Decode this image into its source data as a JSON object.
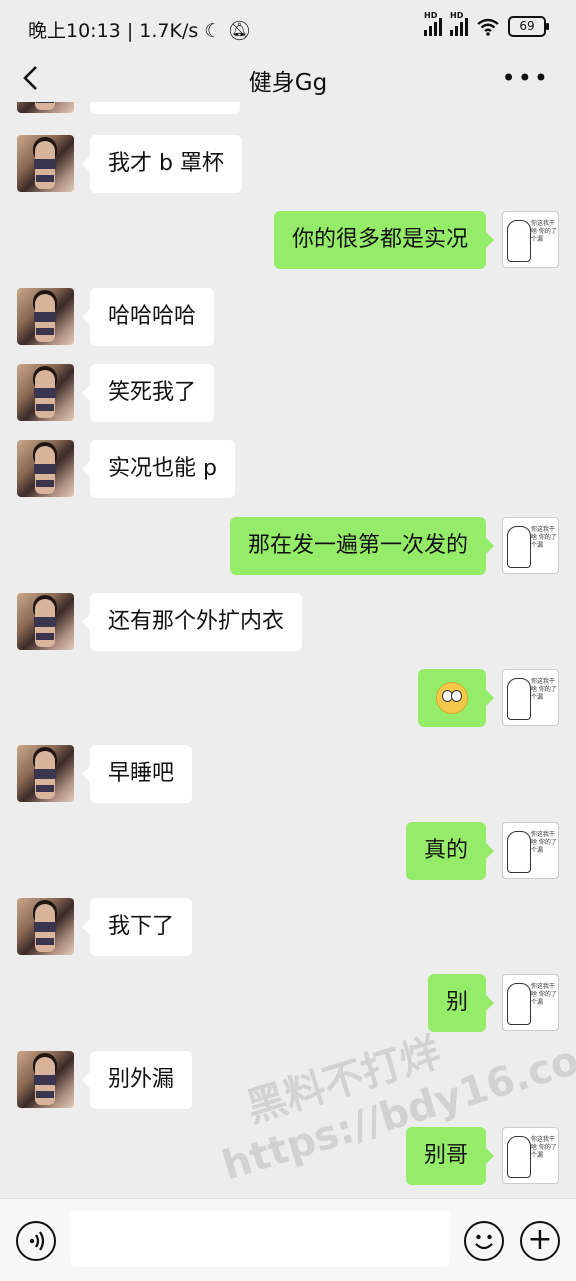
{
  "status": {
    "time": "晚上10:13",
    "speed": "1.7K/s",
    "battery": "69"
  },
  "nav": {
    "title": "健身Gg"
  },
  "messages": [
    {
      "side": "in",
      "text": "我才 b 罩杯"
    },
    {
      "side": "out",
      "text": "你的很多都是实况"
    },
    {
      "side": "in",
      "text": "哈哈哈哈"
    },
    {
      "side": "in",
      "text": "笑死我了"
    },
    {
      "side": "in",
      "text": "实况也能 p"
    },
    {
      "side": "out",
      "text": "那在发一遍第一次发的"
    },
    {
      "side": "in",
      "text": "还有那个外扩内衣"
    },
    {
      "side": "out",
      "text": "",
      "emoji": "flushed-face-emoji"
    },
    {
      "side": "in",
      "text": "早睡吧"
    },
    {
      "side": "out",
      "text": "真的"
    },
    {
      "side": "in",
      "text": "我下了"
    },
    {
      "side": "out",
      "text": "别"
    },
    {
      "side": "in",
      "text": "别外漏"
    },
    {
      "side": "out",
      "text": "别哥"
    }
  ],
  "my_avatar_caption": "你这我干啥 你的了个漏",
  "colors": {
    "out_bubble": "#95ec69",
    "in_bubble": "#ffffff",
    "background": "#ededed"
  },
  "watermark": {
    "line1": "黑料不打烊",
    "line2": "https://bdy16.co"
  }
}
